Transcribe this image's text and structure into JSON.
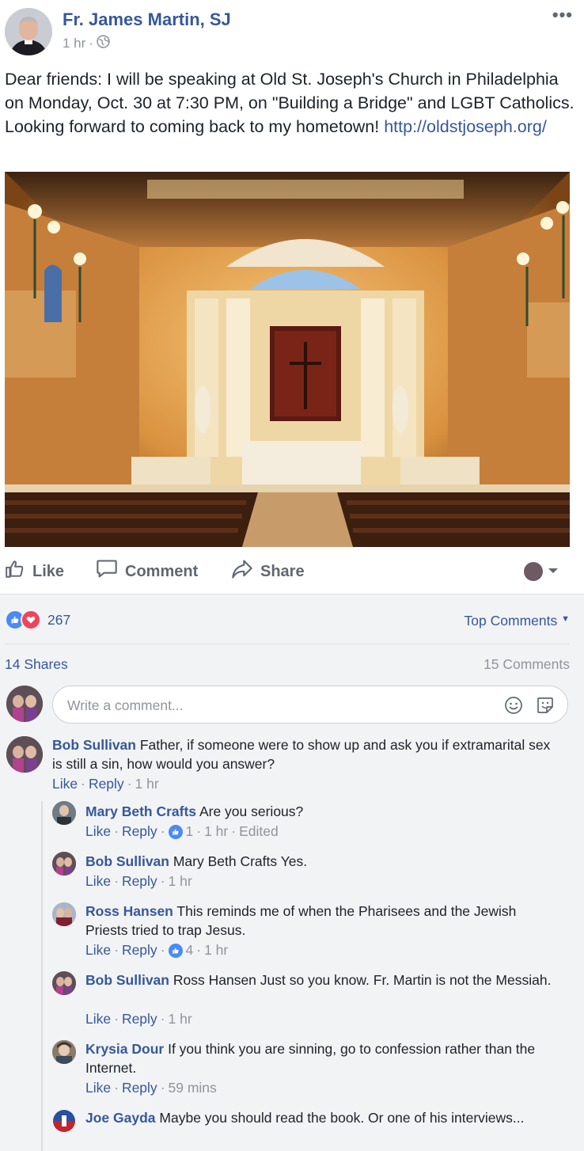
{
  "post": {
    "author": "Fr. James Martin, SJ",
    "time": "1 hr",
    "sep": "·",
    "text_before_link": "Dear friends: I will be speaking at Old St. Joseph's Church in Philadelphia on Monday, Oct. 30 at 7:30 PM, on \"Building a Bridge\" and LGBT Catholics. Looking forward to coming back to my hometown! ",
    "link": "http://oldstjoseph.org/"
  },
  "actions": {
    "like": "Like",
    "comment": "Comment",
    "share": "Share"
  },
  "stats": {
    "reaction_count": "267",
    "top_comments": "Top Comments",
    "shares": "14 Shares",
    "comments": "15 Comments"
  },
  "composer": {
    "placeholder": "Write a comment..."
  },
  "comments": [
    {
      "name": "Bob Sullivan",
      "text": "Father, if someone were to show up and ask you if extramarital sex is still a sin, how would you answer?",
      "like": "Like",
      "reply": "Reply",
      "time": "1 hr"
    },
    {
      "name": "Mary Beth Crafts",
      "text": "Are you serious?",
      "like": "Like",
      "reply": "Reply",
      "likes": "1",
      "time": "1 hr",
      "edited": "Edited"
    },
    {
      "name": "Bob Sullivan",
      "text": "Mary Beth Crafts Yes.",
      "like": "Like",
      "reply": "Reply",
      "time": "1 hr"
    },
    {
      "name": "Ross Hansen",
      "text": "This reminds me of when the Pharisees and the Jewish Priests tried to trap Jesus.",
      "like": "Like",
      "reply": "Reply",
      "likes": "4",
      "time": "1 hr"
    },
    {
      "name": "Bob Sullivan",
      "text": "Ross Hansen Just so you know. Fr. Martin is not the Messiah.",
      "like": "Like",
      "reply": "Reply",
      "time": "1 hr"
    },
    {
      "name": "Krysia Dour",
      "text": "If you think you are sinning, go to confession rather than the Internet.",
      "like": "Like",
      "reply": "Reply",
      "time": "59 mins"
    },
    {
      "name": "Joe Gayda",
      "text": "Maybe you should read the book. Or one of his interviews..."
    }
  ],
  "colors": {
    "link": "#365899",
    "muted": "#90949c",
    "like_blue": "#4a8af4",
    "love_red": "#f0435c"
  }
}
